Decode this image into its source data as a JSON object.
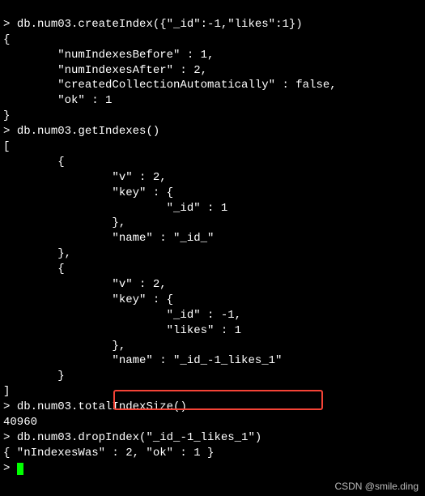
{
  "lines": {
    "p1": "> ",
    "cmd1": "db.num03.createIndex({\"_id\":-1,\"likes\":1})",
    "l2": "{",
    "l3": "        \"numIndexesBefore\" : 1,",
    "l4": "        \"numIndexesAfter\" : 2,",
    "l5": "        \"createdCollectionAutomatically\" : false,",
    "l6": "        \"ok\" : 1",
    "l7": "}",
    "p2": "> ",
    "cmd2": "db.num03.getIndexes()",
    "l9": "[",
    "l10": "        {",
    "l11": "                \"v\" : 2,",
    "l12": "                \"key\" : {",
    "l13": "                        \"_id\" : 1",
    "l14": "                },",
    "l15": "                \"name\" : \"_id_\"",
    "l16": "        },",
    "l17": "        {",
    "l18": "                \"v\" : 2,",
    "l19": "                \"key\" : {",
    "l20": "                        \"_id\" : -1,",
    "l21": "                        \"likes\" : 1",
    "l22": "                },",
    "l23": "                \"name\" : \"_id_-1_likes_1\"",
    "l24": "        }",
    "l25": "]",
    "p3": "> ",
    "cmd3": "db.num03.totalIndexSize()",
    "l27": "40960",
    "p4": "> ",
    "cmd4": "db.num03.dropIndex(\"_id_-1_likes_1\")",
    "l29": "{ \"nIndexesWas\" : 2, \"ok\" : 1 }",
    "p5": "> "
  },
  "watermark": "CSDN @smile.ding"
}
